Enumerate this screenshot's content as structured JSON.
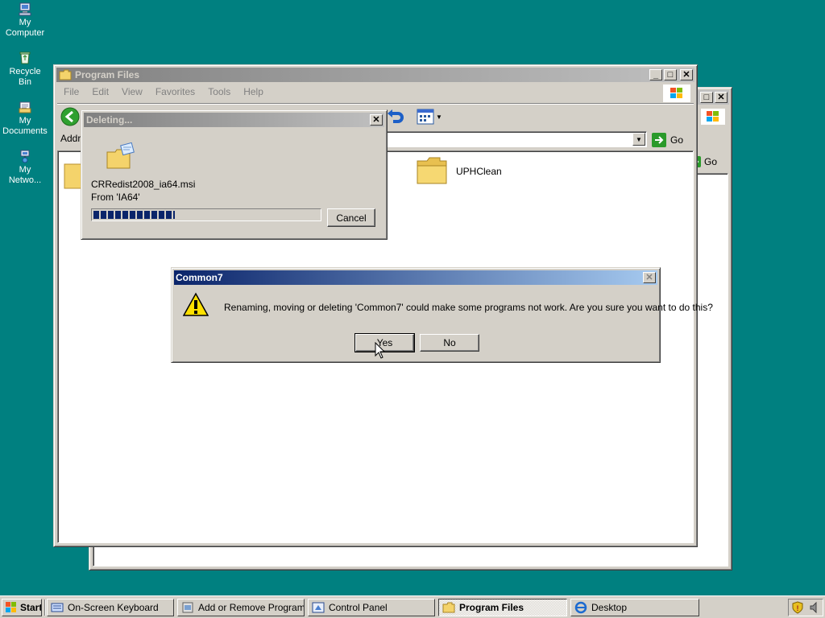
{
  "desktop": {
    "icons": [
      {
        "label": "My Computer"
      },
      {
        "label": "Recycle Bin"
      },
      {
        "label": "My Documents"
      },
      {
        "label": "My Netwo..."
      }
    ]
  },
  "back_window": {
    "go_label": "Go"
  },
  "explorer": {
    "title": "Program Files",
    "menu": [
      "File",
      "Edit",
      "View",
      "Favorites",
      "Tools",
      "Help"
    ],
    "address_label": "Addr",
    "go_label": "Go",
    "folders": [
      {
        "name": "UPHClean"
      }
    ]
  },
  "deleting_dialog": {
    "title": "Deleting...",
    "filename": "CRRedist2008_ia64.msi",
    "from": "From 'IA64'",
    "progress": 0.36,
    "cancel_label": "Cancel"
  },
  "confirm_dialog": {
    "title": "Common7",
    "message": "Renaming, moving or deleting 'Common7' could make some programs not work. Are you sure you want to do this?",
    "yes_label": "Yes",
    "no_label": "No"
  },
  "taskbar": {
    "start_label": "Start",
    "tasks": [
      {
        "label": "On-Screen Keyboard"
      },
      {
        "label": "Add or Remove Programs"
      },
      {
        "label": "Control Panel"
      },
      {
        "label": "Program Files"
      },
      {
        "label": "Desktop"
      }
    ]
  },
  "colors": {
    "desktop": "#008080",
    "active_title": "#0a246a",
    "progress": "#0a246a"
  }
}
